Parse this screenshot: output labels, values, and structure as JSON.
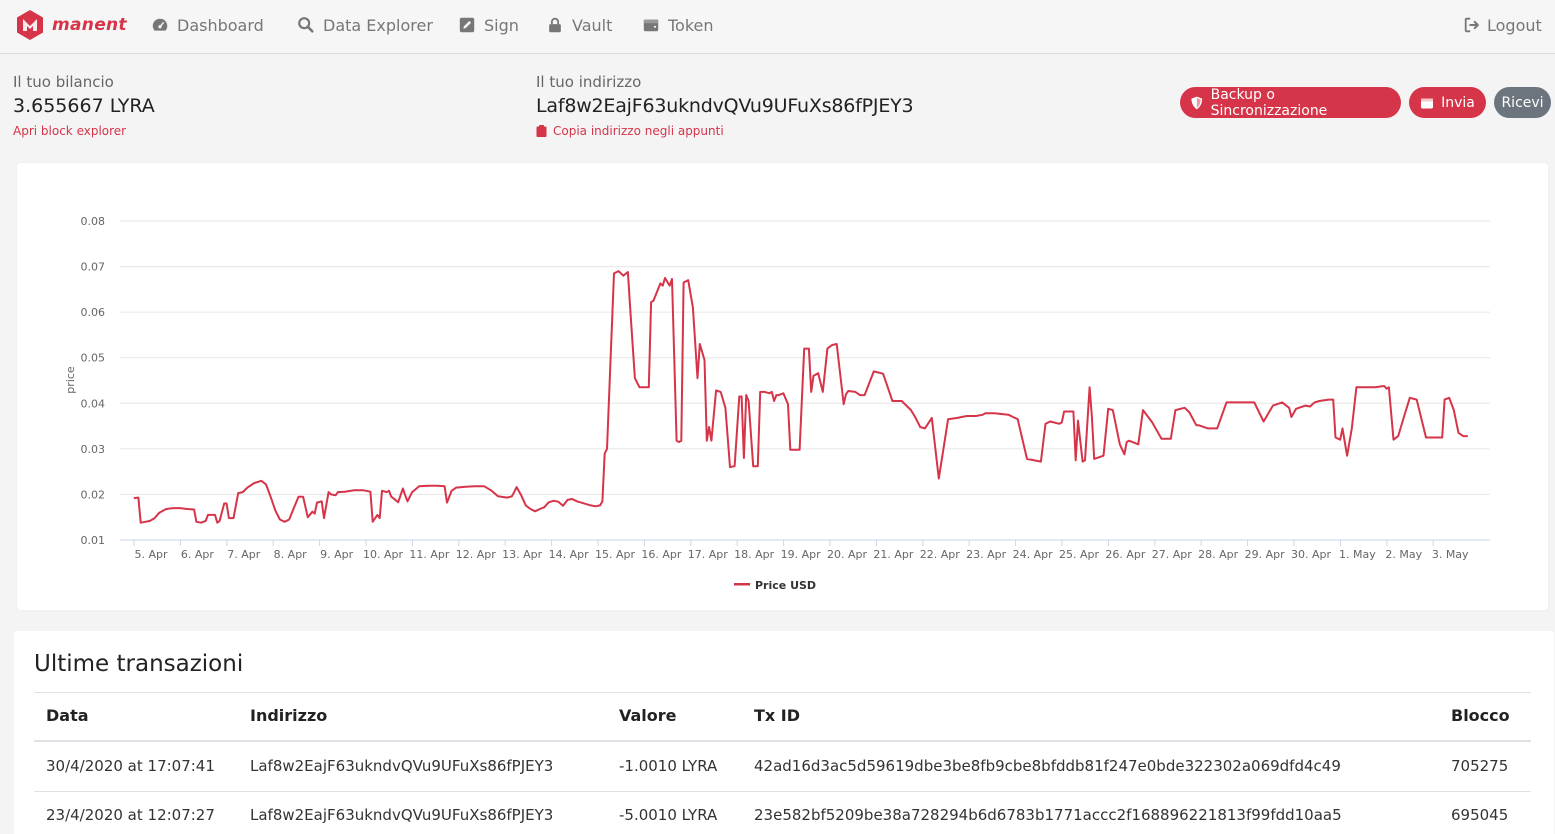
{
  "brand": {
    "name": "manent",
    "color": "#d63449"
  },
  "nav": {
    "items": [
      {
        "label": "Dashboard",
        "icon": "speedometer-icon"
      },
      {
        "label": "Data Explorer",
        "icon": "search-icon"
      },
      {
        "label": "Sign",
        "icon": "edit-icon"
      },
      {
        "label": "Vault",
        "icon": "lock-icon"
      },
      {
        "label": "Token",
        "icon": "wallet-icon"
      }
    ],
    "logout": "Logout"
  },
  "balance": {
    "label": "Il tuo bilancio",
    "value": "3.655667 LYRA",
    "link": "Apri block explorer"
  },
  "address": {
    "label": "Il tuo indirizzo",
    "value": "Laf8w2EajF63ukndvQVu9UFuXs86fPJEY3",
    "copy": "Copia indirizzo negli appunti"
  },
  "actions": {
    "backup": "Backup o Sincronizzazione",
    "send": "Invia",
    "receive": "Ricevi"
  },
  "chart_data": {
    "type": "line",
    "title": "",
    "xlabel": "",
    "ylabel": "price",
    "ylim": [
      0.01,
      0.08
    ],
    "yticks": [
      "0.08",
      "0.07",
      "0.06",
      "0.05",
      "0.04",
      "0.03",
      "0.02",
      "0.01"
    ],
    "xticks": [
      "5. Apr",
      "6. Apr",
      "7. Apr",
      "8. Apr",
      "9. Apr",
      "10. Apr",
      "11. Apr",
      "12. Apr",
      "13. Apr",
      "14. Apr",
      "15. Apr",
      "16. Apr",
      "17. Apr",
      "18. Apr",
      "19. Apr",
      "20. Apr",
      "21. Apr",
      "22. Apr",
      "23. Apr",
      "24. Apr",
      "25. Apr",
      "26. Apr",
      "27. Apr",
      "28. Apr",
      "29. Apr",
      "30. Apr",
      "1. May",
      "2. May",
      "3. May"
    ],
    "legend_position": "bottom-center",
    "grid": true,
    "series": [
      {
        "name": "Price USD",
        "color": "#d63449",
        "x": [
          4.65,
          4.75,
          4.8,
          4.9,
          5.0,
          5.1,
          5.2,
          5.35,
          5.5,
          5.65,
          5.8,
          5.95,
          6.0,
          6.1,
          6.2,
          6.25,
          6.4,
          6.45,
          6.5,
          6.6,
          6.65,
          6.7,
          6.8,
          6.9,
          7.0,
          7.1,
          7.25,
          7.4,
          7.5,
          7.6,
          7.7,
          7.8,
          7.9,
          8.0,
          8.1,
          8.2,
          8.3,
          8.4,
          8.5,
          8.55,
          8.6,
          8.7,
          8.75,
          8.85,
          8.9,
          9.0,
          9.05,
          9.2,
          9.4,
          9.6,
          9.75,
          9.8,
          9.9,
          9.95,
          10.0,
          10.1,
          10.15,
          10.2,
          10.35,
          10.45,
          10.5,
          10.55,
          10.65,
          10.8,
          11.0,
          11.2,
          11.35,
          11.4,
          11.5,
          11.6,
          11.8,
          12.0,
          12.2,
          12.35,
          12.5,
          12.7,
          12.8,
          12.85,
          12.9,
          13.0,
          13.1,
          13.2,
          13.3,
          13.4,
          13.5,
          13.55,
          13.6,
          13.7,
          13.8,
          13.9,
          14.0,
          14.1,
          14.2,
          14.5,
          14.6,
          14.7,
          14.75,
          14.8,
          14.85,
          15.0,
          15.1,
          15.2,
          15.3,
          15.35,
          15.45,
          15.55,
          15.75,
          15.8,
          15.85,
          16.0,
          16.05,
          16.1,
          16.2,
          16.25,
          16.35,
          16.4,
          16.45,
          16.5,
          16.6,
          16.7,
          16.8,
          16.85,
          16.95,
          17.0,
          17.05,
          17.1,
          17.2,
          17.3,
          17.4,
          17.5,
          17.6,
          17.7,
          17.75,
          17.8,
          17.85,
          17.9,
          18.0,
          18.1,
          18.15,
          18.25,
          18.35,
          18.4,
          18.45,
          18.5,
          18.55,
          18.65,
          18.75,
          18.8,
          19.0,
          19.1,
          19.2,
          19.25,
          19.3,
          19.4,
          19.5,
          19.6,
          19.7,
          19.8,
          19.95,
          20.0,
          20.05,
          20.2,
          20.3,
          20.4,
          20.6,
          20.8,
          21.0,
          21.2,
          21.4,
          21.5,
          21.55,
          21.6,
          21.7,
          21.85,
          22.0,
          22.2,
          22.4,
          22.6,
          22.8,
          22.95,
          23.0,
          23.2,
          23.5,
          23.6,
          23.7,
          23.9,
          24.2,
          24.3,
          24.4,
          24.6,
          24.65,
          24.7,
          24.9,
          24.95,
          25.0,
          25.1,
          25.15,
          25.25,
          25.3,
          25.35,
          25.55,
          25.65,
          25.75,
          25.9,
          26.0,
          26.05,
          26.1,
          26.3,
          26.4,
          26.6,
          26.8,
          27.0,
          27.1,
          27.3,
          27.4,
          27.55,
          27.6,
          27.8,
          28.0,
          28.2,
          28.3,
          28.35,
          28.6,
          28.8,
          29.0,
          29.2,
          29.4,
          29.55,
          29.6,
          29.7,
          29.9,
          30.0,
          30.1,
          30.2,
          30.4,
          30.5,
          30.55,
          30.65,
          30.7,
          30.8,
          30.9,
          31.0,
          31.2,
          31.4,
          31.6,
          31.65,
          31.7,
          31.8,
          31.9,
          32.0,
          32.15,
          32.3,
          32.5,
          32.6,
          32.7,
          32.85,
          32.9,
          33.0,
          33.1,
          33.2,
          33.3,
          33.4
        ],
        "y": [
          0.0192,
          0.0193,
          0.0138,
          0.014,
          0.0142,
          0.0148,
          0.016,
          0.0168,
          0.017,
          0.017,
          0.0168,
          0.0167,
          0.014,
          0.0138,
          0.0142,
          0.0155,
          0.0155,
          0.0138,
          0.0142,
          0.018,
          0.018,
          0.0148,
          0.0148,
          0.0203,
          0.0205,
          0.0215,
          0.0225,
          0.023,
          0.0222,
          0.0195,
          0.0165,
          0.0145,
          0.014,
          0.0145,
          0.017,
          0.0195,
          0.0195,
          0.015,
          0.0162,
          0.0158,
          0.0182,
          0.0185,
          0.0148,
          0.0205,
          0.02,
          0.0198,
          0.0205,
          0.0206,
          0.0209,
          0.0209,
          0.0206,
          0.014,
          0.0155,
          0.0148,
          0.0208,
          0.0205,
          0.0208,
          0.0195,
          0.0183,
          0.0213,
          0.0198,
          0.0185,
          0.0205,
          0.0218,
          0.0219,
          0.0219,
          0.0218,
          0.0182,
          0.0208,
          0.0215,
          0.0217,
          0.0218,
          0.0218,
          0.0209,
          0.0196,
          0.0193,
          0.0196,
          0.0205,
          0.0216,
          0.0198,
          0.0176,
          0.0168,
          0.0163,
          0.0168,
          0.0172,
          0.0178,
          0.0183,
          0.0186,
          0.0184,
          0.0175,
          0.0188,
          0.019,
          0.0185,
          0.0176,
          0.0174,
          0.0176,
          0.0185,
          0.029,
          0.03,
          0.0685,
          0.069,
          0.068,
          0.0688,
          0.0608,
          0.0455,
          0.0435,
          0.0435,
          0.0622,
          0.0625,
          0.0663,
          0.0658,
          0.0675,
          0.0658,
          0.0673,
          0.0318,
          0.0315,
          0.0318,
          0.0665,
          0.067,
          0.061,
          0.0455,
          0.053,
          0.0495,
          0.0318,
          0.0348,
          0.0318,
          0.0428,
          0.0425,
          0.039,
          0.026,
          0.0262,
          0.0415,
          0.0415,
          0.028,
          0.0418,
          0.0405,
          0.0262,
          0.0262,
          0.0425,
          0.0425,
          0.0422,
          0.0425,
          0.0405,
          0.0418,
          0.0418,
          0.0422,
          0.0398,
          0.0298,
          0.0298,
          0.052,
          0.052,
          0.0425,
          0.046,
          0.0466,
          0.0425,
          0.052,
          0.0528,
          0.053,
          0.0398,
          0.042,
          0.0427,
          0.0425,
          0.0418,
          0.0418,
          0.047,
          0.0465,
          0.0405,
          0.0405,
          0.0385,
          0.0368,
          0.0358,
          0.0348,
          0.0345,
          0.0368,
          0.0235,
          0.0365,
          0.0368,
          0.0372,
          0.0372,
          0.0375,
          0.0378,
          0.0378,
          0.0375,
          0.037,
          0.0365,
          0.0278,
          0.0272,
          0.0355,
          0.036,
          0.0355,
          0.0358,
          0.0382,
          0.0382,
          0.0275,
          0.0362,
          0.0272,
          0.0275,
          0.0435,
          0.037,
          0.0278,
          0.0285,
          0.0388,
          0.0385,
          0.031,
          0.0288,
          0.0315,
          0.0318,
          0.031,
          0.0385,
          0.0358,
          0.0322,
          0.0322,
          0.0385,
          0.039,
          0.038,
          0.0352,
          0.0352,
          0.0345,
          0.0345,
          0.0402,
          0.0402,
          0.0402,
          0.0402,
          0.0402,
          0.036,
          0.0395,
          0.0402,
          0.039,
          0.037,
          0.0388,
          0.0395,
          0.0393,
          0.0402,
          0.0405,
          0.0408,
          0.0408,
          0.0325,
          0.032,
          0.0345,
          0.0285,
          0.0345,
          0.0435,
          0.0435,
          0.0435,
          0.0438,
          0.0432,
          0.0435,
          0.032,
          0.0328,
          0.0362,
          0.0412,
          0.0408,
          0.0325,
          0.0325,
          0.0325,
          0.0325,
          0.0408,
          0.0412,
          0.0385,
          0.0335,
          0.0328,
          0.0328
        ]
      }
    ]
  },
  "transactions": {
    "title": "Ultime transazioni",
    "headers": [
      "Data",
      "Indirizzo",
      "Valore",
      "Tx ID",
      "Blocco"
    ],
    "rows": [
      [
        "30/4/2020 at 17:07:41",
        "Laf8w2EajF63ukndvQVu9UFuXs86fPJEY3",
        "-1.0010 LYRA",
        "42ad16d3ac5d59619dbe3be8fb9cbe8bfddb81f247e0bde322302a069dfd4c49",
        "705275"
      ],
      [
        "23/4/2020 at 12:07:27",
        "Laf8w2EajF63ukndvQVu9UFuXs86fPJEY3",
        "-5.0010 LYRA",
        "23e582bf5209be38a728294b6d6783b1771accc2f168896221813f99fdd10aa5",
        "695045"
      ]
    ]
  }
}
